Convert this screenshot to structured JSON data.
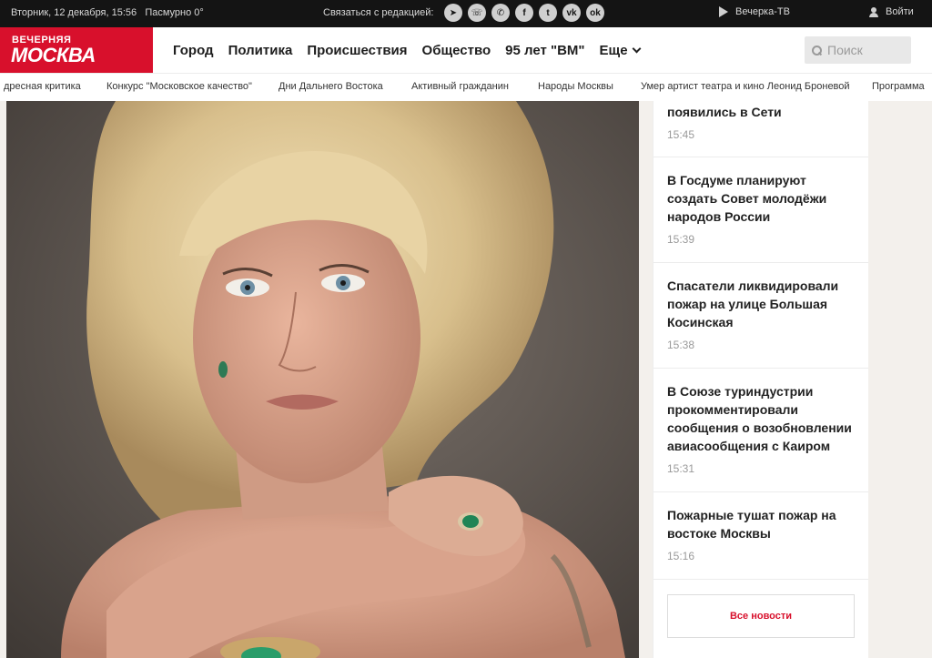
{
  "topbar": {
    "date": "Вторник, 12 декабря, 15:56",
    "weather": "Пасмурно 0°",
    "contact_label": "Связаться с редакцией:",
    "socials": [
      {
        "name": "telegram-icon",
        "glyph": "➤"
      },
      {
        "name": "viber-icon",
        "glyph": "☏"
      },
      {
        "name": "whatsapp-icon",
        "glyph": "✆"
      },
      {
        "name": "facebook-icon",
        "glyph": "f"
      },
      {
        "name": "twitter-icon",
        "glyph": "t"
      },
      {
        "name": "vk-icon",
        "glyph": "vk"
      },
      {
        "name": "odnoklassniki-icon",
        "glyph": "ok"
      }
    ],
    "tv_label": "Вечерка-ТВ",
    "login_label": "Войти"
  },
  "logo": {
    "line1": "ВЕЧЕРНЯЯ",
    "line2": "МОСКВА"
  },
  "nav": {
    "items": [
      "Город",
      "Политика",
      "Происшествия",
      "Общество",
      "95 лет \"ВМ\""
    ],
    "more_label": "Еще"
  },
  "search": {
    "placeholder": "Поиск"
  },
  "tags": [
    "дресная критика",
    "Конкурс \"Московское качество\"",
    "Дни Дальнего Востока",
    "Активный гражданин",
    "Народы Москвы",
    "Умер артист театра и кино Леонид Броневой",
    "Программа"
  ],
  "news": [
    {
      "title": "появились в Сети",
      "time": "15:45"
    },
    {
      "title": "В Госдуме планируют создать Совет молодёжи народов России",
      "time": "15:39"
    },
    {
      "title": "Спасатели ликвидировали пожар на улице Большая Косинская",
      "time": "15:38"
    },
    {
      "title": "В Союзе туриндустрии прокомментировали сообщения о возобновлении авиасообщения с Каиром",
      "time": "15:31"
    },
    {
      "title": "Пожарные тушат пожар на востоке Москвы",
      "time": "15:16"
    }
  ],
  "all_news_label": "Все новости",
  "colors": {
    "brand_red": "#d8102c",
    "topbar_bg": "#141414"
  }
}
